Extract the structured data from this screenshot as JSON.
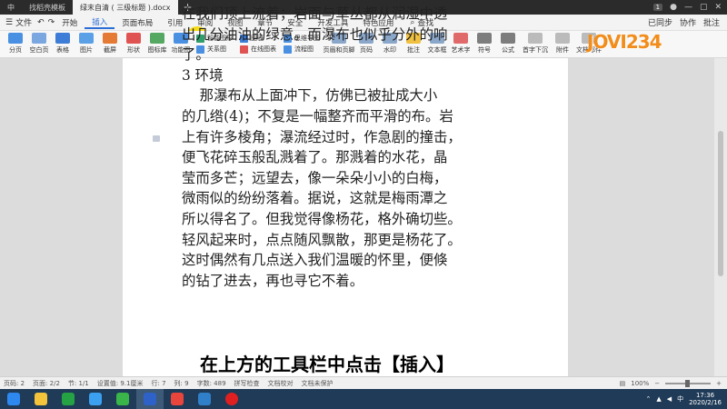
{
  "titlebar": {
    "tabs": [
      {
        "label": "中",
        "active": false
      },
      {
        "label": "找稻壳模板",
        "active": false
      },
      {
        "label": "绿末自清 ( 三级标题 ).docx",
        "active": true
      }
    ],
    "plus_label": "+",
    "badge": "1"
  },
  "menubar": {
    "file_label": "文件",
    "items": [
      "开始",
      "插入",
      "页面布局",
      "引用",
      "审阅",
      "视图",
      "章节",
      "安全",
      "开发工具",
      "特色应用"
    ],
    "active_index": 1,
    "search_label": "查找",
    "sync_label": "已同步",
    "collab_label": "协作",
    "comment_label": "批注"
  },
  "toolbar": {
    "buttons": [
      {
        "label": "分页",
        "color": "#4a90e2",
        "icon": "page-break-icon"
      },
      {
        "label": "空白页",
        "color": "#7aa7e0",
        "icon": "blank-page-icon"
      },
      {
        "label": "表格",
        "color": "#3d7dd8",
        "icon": "table-icon"
      },
      {
        "label": "图片",
        "color": "#5aa0e6",
        "icon": "picture-icon"
      },
      {
        "label": "截屏",
        "color": "#e57a34",
        "icon": "screenshot-icon"
      },
      {
        "label": "形状",
        "color": "#e05353",
        "icon": "shape-icon"
      },
      {
        "label": "图标库",
        "color": "#55a861",
        "icon": "icon-library-icon"
      },
      {
        "label": "功能图",
        "color": "#4a90e2",
        "icon": "function-chart-icon"
      }
    ],
    "group1": [
      "智能图形",
      "关系图"
    ],
    "group2": [
      "图表",
      "在线图表"
    ],
    "group3": [
      "思维导图",
      "流程图"
    ],
    "buttons2": [
      {
        "label": "页眉和页脚",
        "color": "#8aa6c8",
        "icon": "header-footer-icon"
      },
      {
        "label": "页码",
        "color": "#8aa6c8",
        "icon": "page-number-icon"
      },
      {
        "label": "水印",
        "color": "#8aa6c8",
        "icon": "watermark-icon"
      },
      {
        "label": "批注",
        "color": "#f0c040",
        "icon": "comment-icon"
      },
      {
        "label": "文本框",
        "color": "#8aa6c8",
        "icon": "text-box-icon"
      },
      {
        "label": "艺术字",
        "color": "#e06a6a",
        "icon": "word-art-icon"
      },
      {
        "label": "符号",
        "color": "#7d7d7d",
        "icon": "symbol-icon"
      },
      {
        "label": "公式",
        "color": "#7d7d7d",
        "icon": "formula-icon"
      }
    ],
    "tail": [
      "首字下沉",
      "附件",
      "文档部件"
    ],
    "logo": "JOVI234"
  },
  "document": {
    "lines": [
      "在我们顶上流着；岩面与草丛都从润湿中透",
      "出几分油油的绿意。而瀑布也似乎分外的响",
      "了。",
      "3 环境",
      "    那瀑布从上面冲下，仿佛已被扯成大小",
      "的几绺(4)；不复是一幅整齐而平滑的布。岩",
      "上有许多棱角；瀑流经过时，作急剧的撞击，",
      "便飞花碎玉般乱溅着了。那溅着的水花，晶",
      "莹而多芒；远望去，像一朵朵小小的白梅，",
      "微雨似的纷纷落着。据说，这就是梅雨潭之",
      "所以得名了。但我觉得像杨花，格外确切些。",
      "轻风起来时，点点随风飘散，那更是杨花了。",
      "这时偶然有几点送入我们温暖的怀里，便倏",
      "的钻了进去，再也寻它不着。"
    ]
  },
  "subtitle": "在上方的工具栏中点击【插入】",
  "statusbar": {
    "items": [
      "页码: 2",
      "页面: 2/2",
      "节: 1/1",
      "设置值: 9.1厘米",
      "行: 7",
      "列: 9",
      "字数: 489",
      "拼写检查",
      "文档校对",
      "文档未保护"
    ],
    "zoom": "100%"
  },
  "taskbar": {
    "apps": [
      {
        "name": "start-button",
        "color": "#2d89ef"
      },
      {
        "name": "file-explorer-app",
        "color": "#f3c33c"
      },
      {
        "name": "store-app",
        "color": "#25a244"
      },
      {
        "name": "baidu-netdisk-app",
        "color": "#3ba0f0"
      },
      {
        "name": "browser-360-app",
        "color": "#39b54a"
      },
      {
        "name": "wps-writer-app",
        "color": "#2f62c9"
      },
      {
        "name": "chrome-app",
        "color": "#e8453c"
      },
      {
        "name": "wps-presentation-app",
        "color": "#2f7fc9"
      },
      {
        "name": "screen-recorder-app",
        "color": "#e02020"
      }
    ],
    "ime": "中",
    "time": "17:36",
    "date": "2020/2/16"
  }
}
